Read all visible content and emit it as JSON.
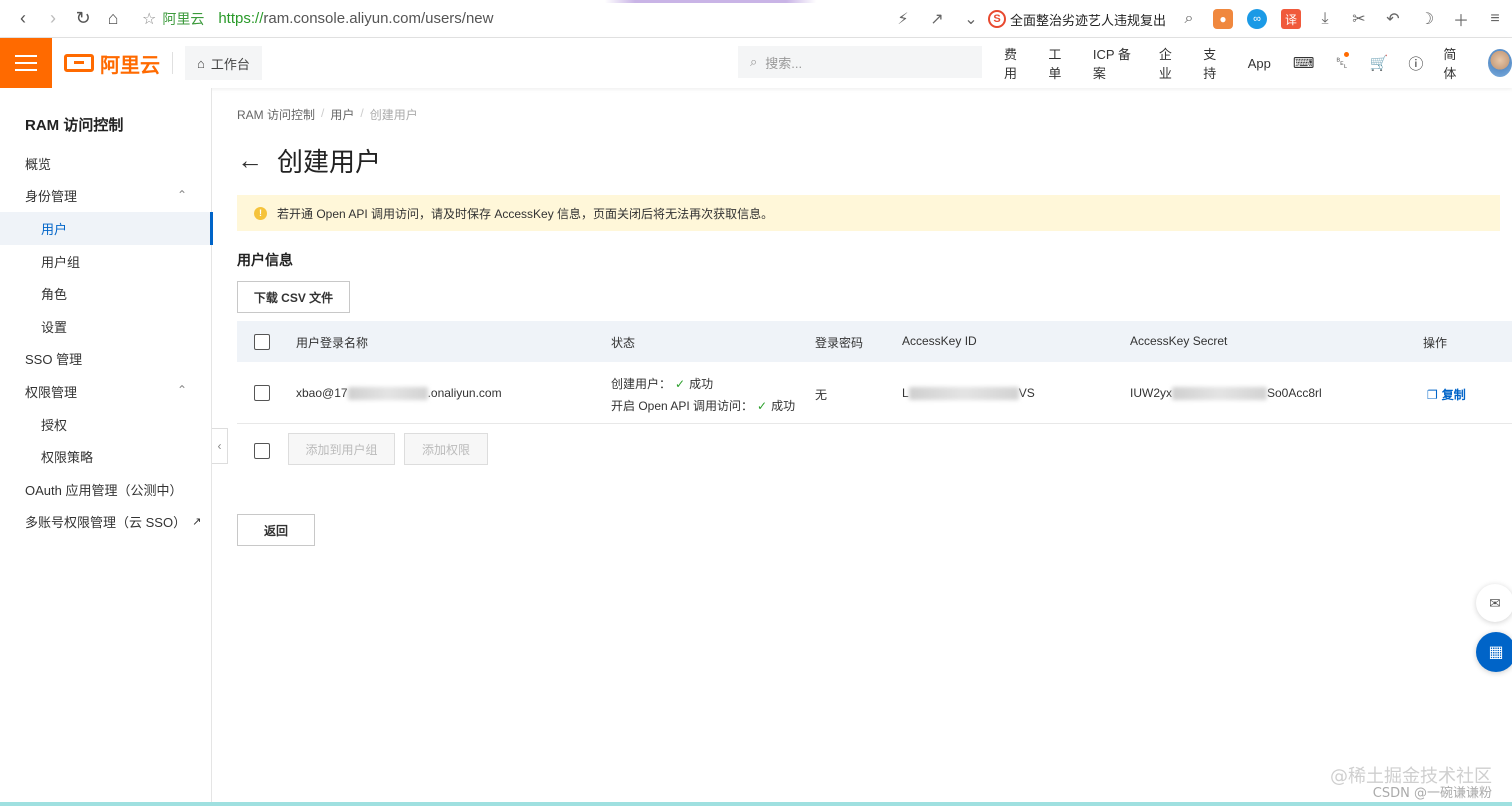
{
  "browser": {
    "site_name": "阿里云",
    "url_scheme": "https://",
    "url_rest": "ram.console.aliyun.com/users/new",
    "news_text": "全面整治劣迹艺人违规复出",
    "sogou_label": "S",
    "translate_label": "译"
  },
  "header": {
    "logo_text": "阿里云",
    "workbench_label": "工作台",
    "search_placeholder": "搜索...",
    "links": [
      "费用",
      "工单",
      "ICP 备案",
      "企业",
      "支持",
      "App"
    ],
    "lang_label": "简体"
  },
  "sidebar": {
    "title": "RAM 访问控制",
    "items": [
      {
        "label": "概览"
      },
      {
        "label": "身份管理"
      },
      {
        "label": "用户"
      },
      {
        "label": "用户组"
      },
      {
        "label": "角色"
      },
      {
        "label": "设置"
      },
      {
        "label": "SSO 管理"
      },
      {
        "label": "权限管理"
      },
      {
        "label": "授权"
      },
      {
        "label": "权限策略"
      },
      {
        "label": "OAuth 应用管理（公测中）"
      },
      {
        "label": "多账号权限管理（云 SSO）"
      }
    ]
  },
  "breadcrumb": [
    "RAM 访问控制",
    "用户",
    "创建用户"
  ],
  "page": {
    "title": "创建用户",
    "alert": "若开通 Open API 调用访问，请及时保存 AccessKey 信息，页面关闭后将无法再次获取信息。",
    "section_title": "用户信息",
    "download_button": "下载 CSV 文件",
    "add_to_group_button": "添加到用户组",
    "add_permission_button": "添加权限",
    "back_button": "返回"
  },
  "table": {
    "headers": {
      "login_name": "用户登录名称",
      "status": "状态",
      "password": "登录密码",
      "ak_id": "AccessKey ID",
      "ak_secret": "AccessKey Secret",
      "actions": "操作"
    },
    "row": {
      "login_prefix": "xbao@17",
      "login_suffix": ".onaliyun.com",
      "status_create_label": "创建用户：",
      "status_create_value": "成功",
      "status_api_label": "开启 Open API 调用访问：",
      "status_api_value": "成功",
      "password": "无",
      "ak_id_prefix": "L",
      "ak_id_suffix": "VS",
      "ak_secret_prefix": "IUW2yx",
      "ak_secret_suffix": "So0Acc8rl",
      "copy_label": "复制"
    }
  },
  "watermark": {
    "line1": "@稀土掘金技术社区",
    "line2": "CSDN @一碗谦谦粉"
  },
  "colors": {
    "brand_orange": "#ff6a00",
    "link_blue": "#0064c8",
    "alert_bg": "#fff7d9",
    "success_green": "#2ca02c"
  }
}
